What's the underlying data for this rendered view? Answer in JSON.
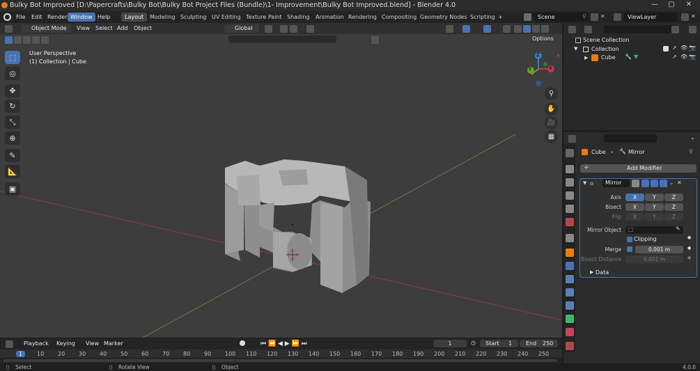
{
  "window": {
    "title": "Bulky Bot Improved [D:\\Papercrafts\\Bulky Bot\\Bulky Bot Project Files (Bundle)\\1- Improvement\\Bulky Bot Improved.blend] - Blender 4.0"
  },
  "menus": [
    "File",
    "Edit",
    "Render",
    "Window",
    "Help"
  ],
  "active_menu": "Window",
  "workspaces": [
    "Layout",
    "Modeling",
    "Sculpting",
    "UV Editing",
    "Texture Paint",
    "Shading",
    "Animation",
    "Rendering",
    "Compositing",
    "Geometry Nodes",
    "Scripting"
  ],
  "active_workspace": "Layout",
  "scene": {
    "name": "Scene",
    "view_layer": "ViewLayer"
  },
  "viewport": {
    "mode": "Object Mode",
    "menu": [
      "View",
      "Select",
      "Add",
      "Object"
    ],
    "orientation": "Global",
    "options": "Options",
    "overlay_title": "User Perspective",
    "overlay_sub": "(1) Collection | Cube",
    "gizmo": {
      "x": "X",
      "y": "Y",
      "z": "Z"
    }
  },
  "outliner": {
    "scene_collection": "Scene Collection",
    "collection": "Collection",
    "object": "Cube"
  },
  "properties": {
    "object": "Cube",
    "modifier_crumb": "Mirror",
    "add_modifier": "Add Modifier",
    "modifier_name": "Mirror",
    "axis_label": "Axis",
    "bisect_label": "Bisect",
    "flip_label": "Flip",
    "axes": [
      "X",
      "Y",
      "Z"
    ],
    "mirror_object_label": "Mirror Object",
    "clipping_label": "Clipping",
    "merge_label": "Merge",
    "merge_value": "0.001 m",
    "bisect_distance_label": "Bisect Distance",
    "bisect_distance_value": "0.001 m",
    "data_label": "Data"
  },
  "timeline": {
    "menus": [
      "Playback",
      "Keying",
      "View",
      "Marker"
    ],
    "current_frame": "1",
    "start_label": "Start",
    "start": "1",
    "end_label": "End",
    "end": "250",
    "ticks": [
      "1",
      "10",
      "20",
      "30",
      "40",
      "50",
      "60",
      "70",
      "80",
      "90",
      "100",
      "110",
      "120",
      "130",
      "140",
      "150",
      "160",
      "170",
      "180",
      "190",
      "200",
      "210",
      "220",
      "230",
      "240",
      "250"
    ]
  },
  "status": {
    "select": "Select",
    "rotate": "Rotate View",
    "object": "Object",
    "version": "4.0.0"
  },
  "colors": {
    "accent": "#4772b3",
    "viewport_bg": "#3d3d3d",
    "x_axis": "#b0454f",
    "y_axis": "#7aa33a",
    "mesh": "#9a9a9a"
  }
}
